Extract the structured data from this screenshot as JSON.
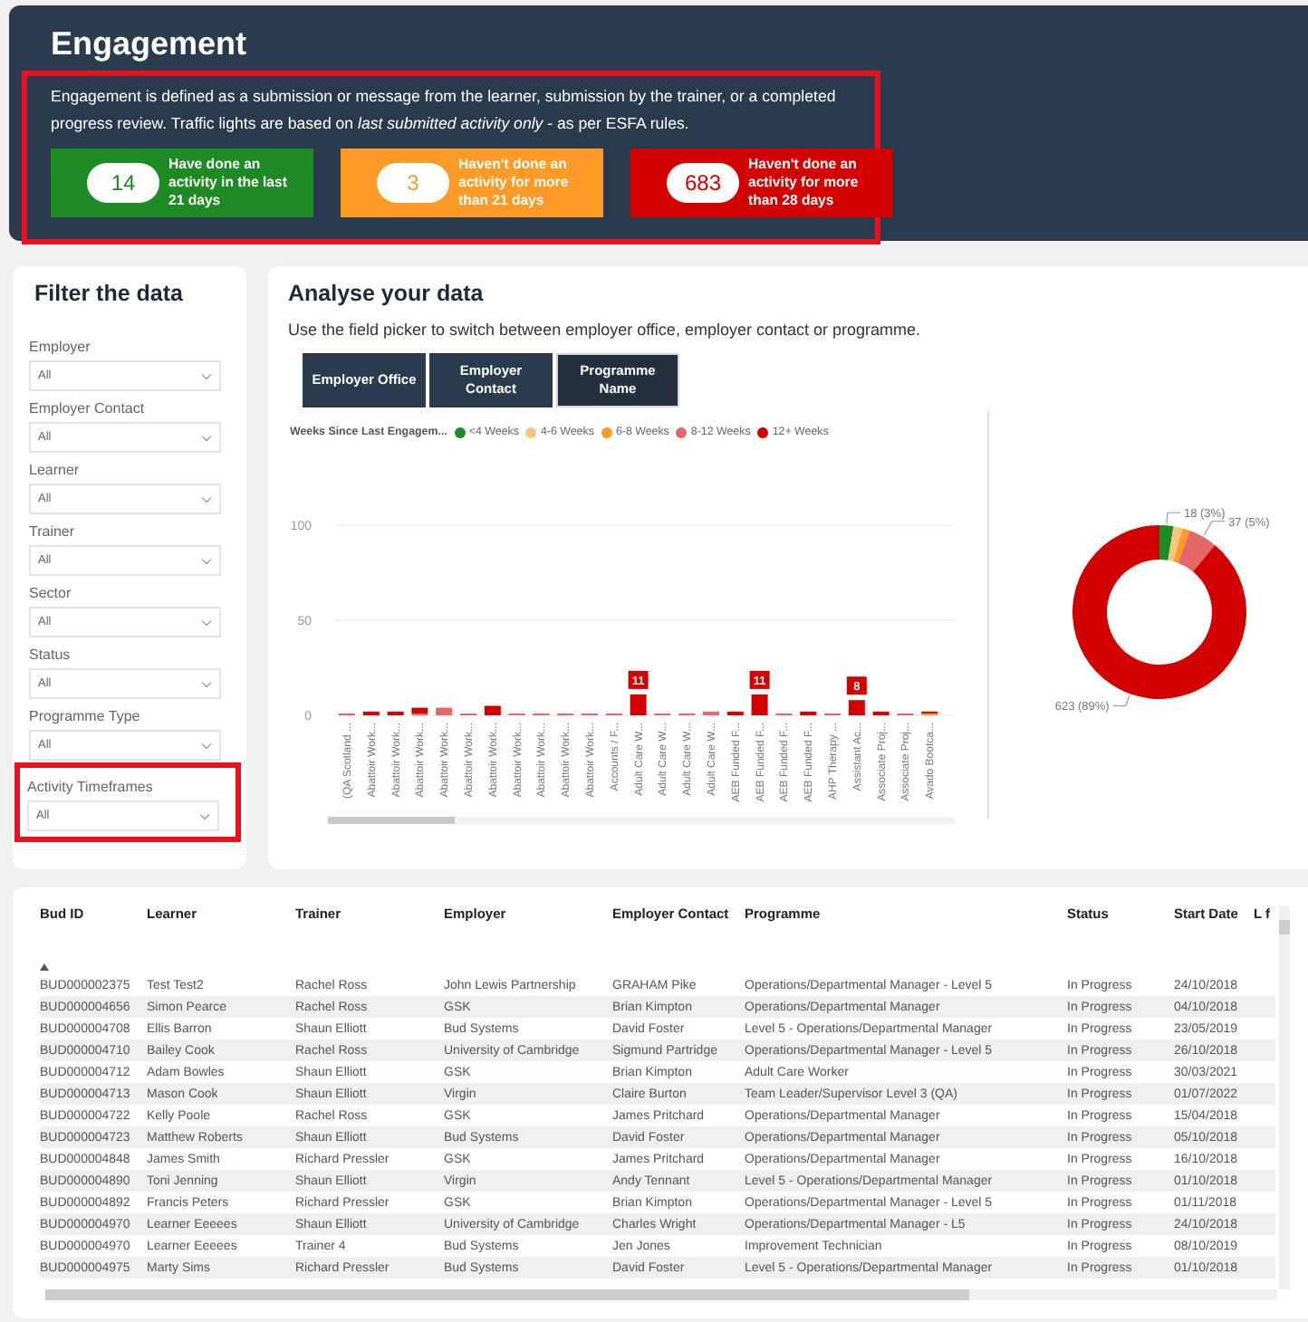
{
  "header": {
    "title": "Engagement",
    "description": "Engagement is defined as a submission or message from the learner, submission by the trainer, or a completed progress review. Traffic lights are based on *last submitted activity only* - as per ESFA rules.",
    "highlighted": true,
    "kpis": [
      {
        "value": "14",
        "label": "Have done an activity in the last 21 days",
        "color": "#1e8a24"
      },
      {
        "value": "3",
        "label": "Haven't done an activity for more than 21 days",
        "color": "#fb9a26"
      },
      {
        "value": "683",
        "label": "Haven't done an activity for more than 28 days",
        "color": "#d30000"
      }
    ]
  },
  "filters": {
    "title": "Filter the data",
    "items": [
      {
        "label": "Employer",
        "value": "All",
        "highlighted": false
      },
      {
        "label": "Employer Contact",
        "value": "All",
        "highlighted": false
      },
      {
        "label": "Learner",
        "value": "All",
        "highlighted": false
      },
      {
        "label": "Trainer",
        "value": "All",
        "highlighted": false
      },
      {
        "label": "Sector",
        "value": "All",
        "highlighted": false
      },
      {
        "label": "Status",
        "value": "All",
        "highlighted": false
      },
      {
        "label": "Programme Type",
        "value": "All",
        "highlighted": false
      },
      {
        "label": "Activity Timeframes",
        "value": "All",
        "highlighted": true
      }
    ]
  },
  "analyse": {
    "title": "Analyse your data",
    "subtitle": "Use the field picker to switch between employer office, employer contact or programme.",
    "field_buttons": [
      {
        "label": "Employer Office",
        "selected": false
      },
      {
        "label": "Employer Contact",
        "selected": false
      },
      {
        "label": "Programme Name",
        "selected": true
      }
    ],
    "bar_chart": {
      "chart_data": {
        "type": "bar",
        "stacked": true,
        "legend": {
          "title": "Weeks Since Last Engagem..."
        },
        "ylim": [
          0,
          100
        ],
        "yticks": [
          0,
          50,
          100
        ],
        "categories": [
          "(QA Scotland ...",
          "Abattoir Work...",
          "Abattoir Work...",
          "Abattoir Work...",
          "Abattoir Work...",
          "Abattoir Work...",
          "Abattoir Work...",
          "Abattoir Work...",
          "Abattoir Work...",
          "Abattoir Work...",
          "Abattoir Work...",
          "Accounts / F...",
          "Adult Care W...",
          "Adult Care W...",
          "Adult Care W...",
          "Adult Care W...",
          "AEB Funded F...",
          "AEB Funded F...",
          "AEB Funded F...",
          "AEB Funded F...",
          "AHP Therapy ...",
          "Assistant Ac...",
          "Associate Proj...",
          "Associate Proj...",
          "Avado Bootca..."
        ],
        "series": [
          {
            "name": "<4 Weeks",
            "color": "#1e8a24",
            "values": [
              0,
              0,
              0,
              0,
              0,
              0,
              0,
              0,
              0,
              0,
              0,
              0,
              0,
              0,
              0,
              0,
              0,
              0,
              0,
              0,
              0,
              0,
              0,
              0,
              0
            ]
          },
          {
            "name": "4-6 Weeks",
            "color": "#fcc47e",
            "values": [
              0,
              0,
              0,
              0,
              0,
              0,
              0,
              0,
              0,
              0,
              0,
              0,
              0,
              0,
              0,
              0,
              0,
              0,
              0,
              0,
              0,
              0,
              0,
              0,
              0
            ]
          },
          {
            "name": "6-8 Weeks",
            "color": "#fb9a26",
            "values": [
              0,
              0,
              0,
              0,
              0,
              0,
              0,
              0,
              0,
              0,
              0,
              0,
              0,
              0,
              0,
              0,
              0,
              0,
              0,
              0,
              0,
              0,
              0,
              0,
              1
            ]
          },
          {
            "name": "8-12 Weeks",
            "color": "#e66767",
            "values": [
              1,
              0,
              0,
              1,
              4,
              1,
              0,
              1,
              1,
              1,
              1,
              1,
              0,
              1,
              1,
              2,
              0,
              0,
              1,
              0,
              1,
              0,
              0,
              1,
              0
            ]
          },
          {
            "name": "12+ Weeks",
            "color": "#d30000",
            "values": [
              0,
              2,
              2,
              3,
              0,
              0,
              5,
              0,
              0,
              0,
              0,
              0,
              11,
              0,
              0,
              0,
              2,
              11,
              0,
              2,
              0,
              8,
              2,
              0,
              1
            ],
            "value_labels": [
              null,
              null,
              null,
              null,
              null,
              null,
              null,
              null,
              null,
              null,
              null,
              null,
              "11",
              null,
              null,
              null,
              null,
              "11",
              null,
              null,
              null,
              "8",
              null,
              null,
              null
            ]
          }
        ]
      }
    },
    "donut_chart": {
      "chart_data": {
        "type": "donut",
        "values": [
          2.6,
          1.7,
          1.4,
          5.3,
          89
        ],
        "value_labels": [
          "18 (3%)",
          null,
          null,
          "37 (5%)",
          "623 (89%)"
        ]
      }
    }
  },
  "table": {
    "columns": [
      {
        "label": "Bud ID",
        "sorted": true
      },
      {
        "label": "Learner",
        "sorted": false
      },
      {
        "label": "Trainer",
        "sorted": false
      },
      {
        "label": "Employer",
        "sorted": false
      },
      {
        "label": "Employer Contact",
        "sorted": false
      },
      {
        "label": "Programme",
        "sorted": false
      },
      {
        "label": "Status",
        "sorted": false
      },
      {
        "label": "Start Date",
        "sorted": false
      },
      {
        "label": "L f",
        "sorted": false
      }
    ],
    "rows": [
      [
        "BUD000002375",
        "Test Test2",
        "Rachel Ross",
        "John Lewis Partnership",
        "GRAHAM Pike",
        "Operations/Departmental Manager - Level 5",
        "In Progress",
        "24/10/2018"
      ],
      [
        "BUD000004656",
        "Simon Pearce",
        "Rachel Ross",
        "GSK",
        "Brian Kimpton",
        "Operations/Departmental Manager",
        "In Progress",
        "04/10/2018"
      ],
      [
        "BUD000004708",
        "Ellis Barron",
        "Shaun Elliott",
        "Bud Systems",
        "David Foster",
        "Level 5 - Operations/Departmental Manager",
        "In Progress",
        "23/05/2019"
      ],
      [
        "BUD000004710",
        "Bailey Cook",
        "Rachel Ross",
        "University of Cambridge",
        "Sigmund Partridge",
        "Operations/Departmental Manager - Level 5",
        "In Progress",
        "26/10/2018"
      ],
      [
        "BUD000004712",
        "Adam Bowles",
        "Shaun Elliott",
        "GSK",
        "Brian Kimpton",
        "Adult Care Worker",
        "In Progress",
        "30/03/2021"
      ],
      [
        "BUD000004713",
        "Mason Cook",
        "Shaun Elliott",
        "Virgin",
        "Claire Burton",
        "Team Leader/Supervisor Level 3 (QA)",
        "In Progress",
        "01/07/2022"
      ],
      [
        "BUD000004722",
        "Kelly Poole",
        "Rachel Ross",
        "GSK",
        "James Pritchard",
        "Operations/Departmental Manager",
        "In Progress",
        "15/04/2018"
      ],
      [
        "BUD000004723",
        "Matthew Roberts",
        "Shaun Elliott",
        "Bud Systems",
        "David Foster",
        "Operations/Departmental Manager",
        "In Progress",
        "05/10/2018"
      ],
      [
        "BUD000004848",
        "James Smith",
        "Richard Pressler",
        "GSK",
        "James Pritchard",
        "Operations/Departmental Manager",
        "In Progress",
        "16/10/2018"
      ],
      [
        "BUD000004890",
        "Toni Jenning",
        "Shaun Elliott",
        "Virgin",
        "Andy Tennant",
        "Level 5 - Operations/Departmental Manager",
        "In Progress",
        "01/10/2018"
      ],
      [
        "BUD000004892",
        "Francis Peters",
        "Richard Pressler",
        "GSK",
        "Brian Kimpton",
        "Operations/Departmental Manager - Level 5",
        "In Progress",
        "01/11/2018"
      ],
      [
        "BUD000004970",
        "Learner Eeeees",
        "Shaun Elliott",
        "University of Cambridge",
        "Charles Wright",
        "Operations/Departmental Manager - L5",
        "In Progress",
        "24/10/2018"
      ],
      [
        "BUD000004970",
        "Learner Eeeees",
        "Trainer 4",
        "Bud Systems",
        "Jen Jones",
        "Improvement Technician",
        "In Progress",
        "08/10/2019"
      ],
      [
        "BUD000004975",
        "Marty Sims",
        "Richard Pressler",
        "Bud Systems",
        "David Foster",
        "Level 5 - Operations/Departmental Manager",
        "In Progress",
        "01/10/2018"
      ]
    ]
  }
}
